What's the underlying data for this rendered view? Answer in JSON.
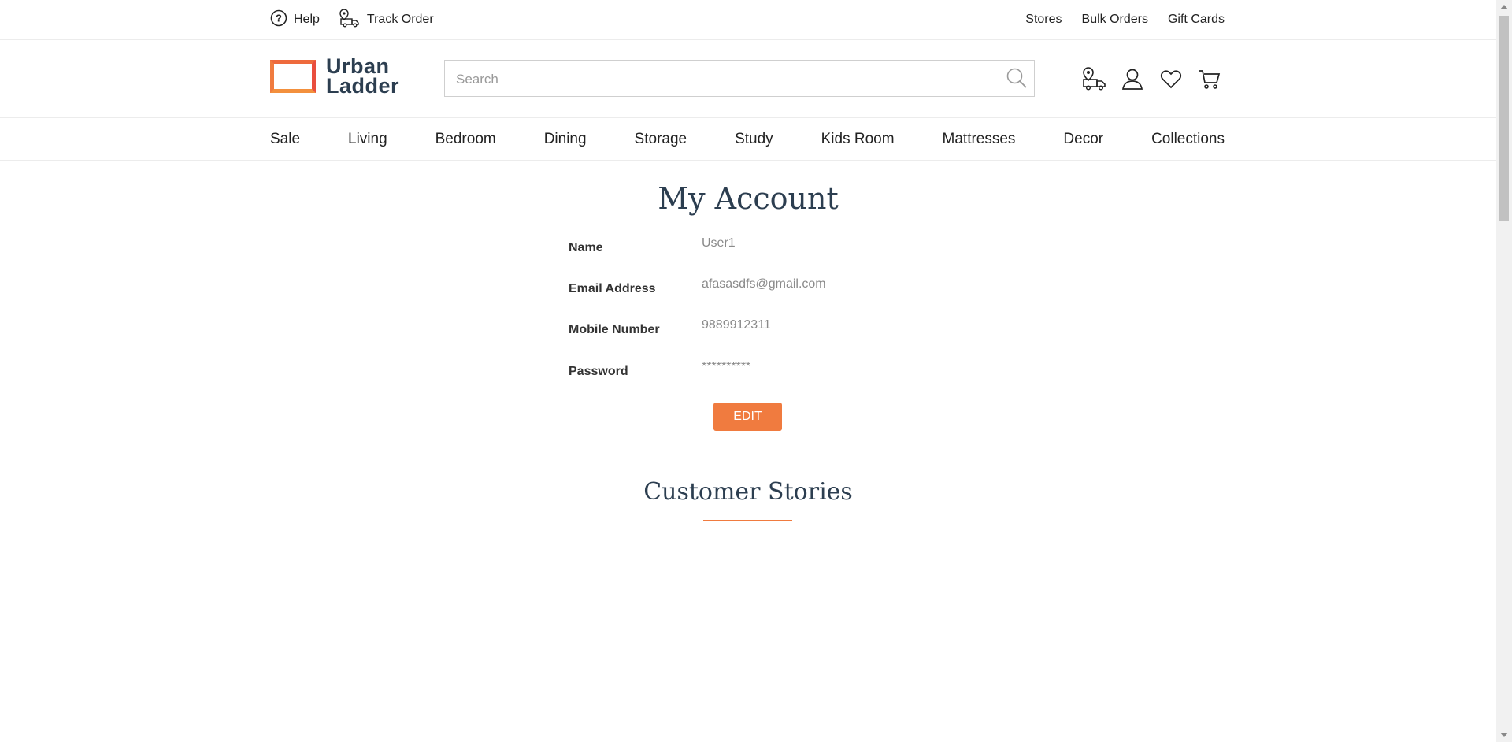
{
  "topbar": {
    "help_label": "Help",
    "track_order_label": "Track Order",
    "stores_label": "Stores",
    "bulk_orders_label": "Bulk Orders",
    "gift_cards_label": "Gift Cards"
  },
  "header": {
    "logo_line1": "Urban",
    "logo_line2": "Ladder",
    "search_placeholder": "Search",
    "icons": [
      "store-locator-icon",
      "user-icon",
      "wishlist-heart-icon",
      "cart-icon"
    ]
  },
  "nav": {
    "items": [
      "Sale",
      "Living",
      "Bedroom",
      "Dining",
      "Storage",
      "Study",
      "Kids Room",
      "Mattresses",
      "Decor",
      "Collections"
    ]
  },
  "account": {
    "title": "My Account",
    "name_label": "Name",
    "name_value": "User1",
    "email_label": "Email Address",
    "email_value": "afasasdfs@gmail.com",
    "mobile_label": "Mobile Number",
    "mobile_value": "9889912311",
    "password_label": "Password",
    "password_value": "**********",
    "edit_label": "EDIT"
  },
  "stories": {
    "title": "Customer Stories"
  },
  "colors": {
    "accent": "#f07b3f",
    "heading": "#2c3e50"
  }
}
